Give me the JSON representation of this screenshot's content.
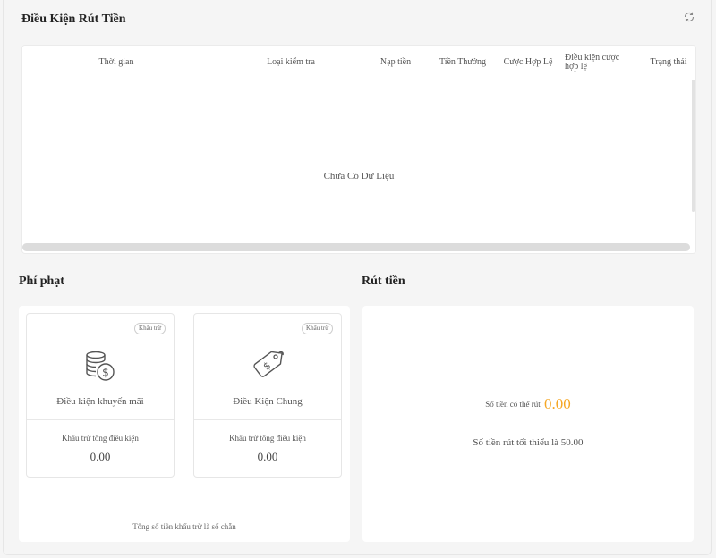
{
  "withdraw_conditions": {
    "title": "Điều Kiện Rút Tiền",
    "refresh_icon": "refresh-icon",
    "columns": [
      "Thời gian",
      "Loại kiểm tra",
      "Nạp tiền",
      "Tiền Thưởng",
      "Cược Hợp Lệ",
      "Điều kiện cược hợp lệ",
      "Trạng thái"
    ],
    "empty_text": "Chưa Có Dữ Liệu"
  },
  "penalty": {
    "title": "Phí phạt",
    "cards": [
      {
        "badge": "Khấu trừ",
        "icon": "coins-dollar-icon",
        "name": "Điều kiện khuyến mãi",
        "sub": "Khấu trừ tổng điều kiện",
        "value": "0.00"
      },
      {
        "badge": "Khấu trừ",
        "icon": "price-tag-dollar-icon",
        "name": "Điều Kiện Chung",
        "sub": "Khấu trừ tổng điều kiện",
        "value": "0.00"
      }
    ],
    "note": "Tổng số tiền khấu trừ là số chẵn"
  },
  "withdraw": {
    "title": "Rút tiền",
    "available_label": "Số tiền có thể rút",
    "available_amount": "0.00",
    "minimum_text": "Số tiền rút tối thiểu là 50.00"
  },
  "colors": {
    "accent": "#f5a623",
    "background": "#f5f5f5"
  }
}
